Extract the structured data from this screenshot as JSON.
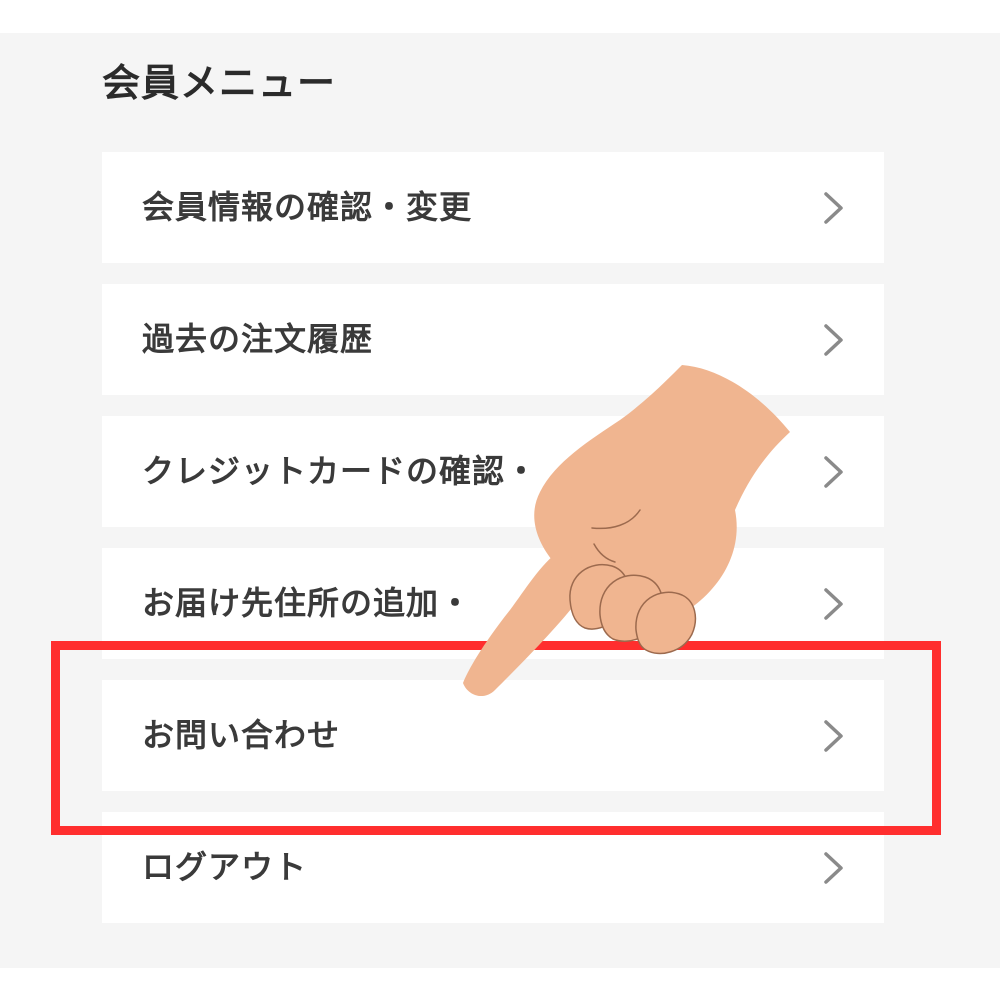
{
  "menu": {
    "title": "会員メニュー",
    "items": [
      {
        "label": "会員情報の確認・変更",
        "icon": "chevron-right-icon"
      },
      {
        "label": "過去の注文履歴",
        "icon": "chevron-right-icon"
      },
      {
        "label": "クレジットカードの確認・",
        "icon": "chevron-right-icon"
      },
      {
        "label": "お届け先住所の追加・",
        "icon": "chevron-right-icon"
      },
      {
        "label": "お問い合わせ",
        "icon": "chevron-right-icon"
      },
      {
        "label": "ログアウト",
        "icon": "chevron-right-icon"
      }
    ]
  },
  "highlight": {
    "target": "お問い合わせ",
    "color": "#ff2e2e"
  },
  "pointer": {
    "icon": "pointing-hand-icon",
    "skin_color": "#f0b590"
  },
  "colors": {
    "panel_background": "#f5f5f5",
    "item_background": "#ffffff",
    "text": "#3a3a3a",
    "chevron": "#8a8a8a"
  }
}
